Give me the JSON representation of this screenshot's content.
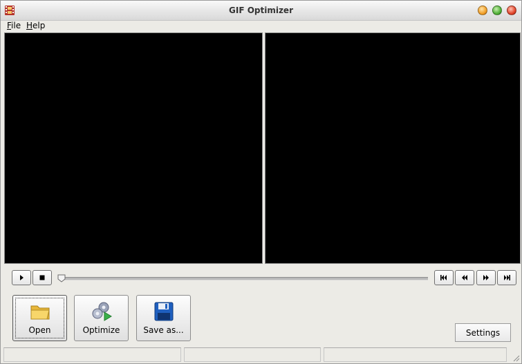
{
  "window": {
    "title": "GIF Optimizer",
    "icon": "film-strip-icon",
    "controls": [
      "minimize-button",
      "maximize-button",
      "close-button"
    ]
  },
  "menu": {
    "file": {
      "label_first": "F",
      "label_rest": "ile"
    },
    "help": {
      "label_first": "H",
      "label_rest": "elp"
    }
  },
  "transport": {
    "play_icon": "play-icon",
    "stop_icon": "stop-icon",
    "position": 0,
    "first_frame_icon": "skip-to-start-icon",
    "prev_frame_icon": "step-back-icon",
    "next_frame_icon": "step-forward-icon",
    "last_frame_icon": "skip-to-end-icon"
  },
  "actions": {
    "open_label": "Open",
    "optimize_label": "Optimize",
    "save_label": "Save as...",
    "settings_label": "Settings"
  },
  "status": {
    "cell1": "",
    "cell2": "",
    "cell3": ""
  },
  "colors": {
    "preview_background": "#000000",
    "window_background": "#ecebe6"
  }
}
